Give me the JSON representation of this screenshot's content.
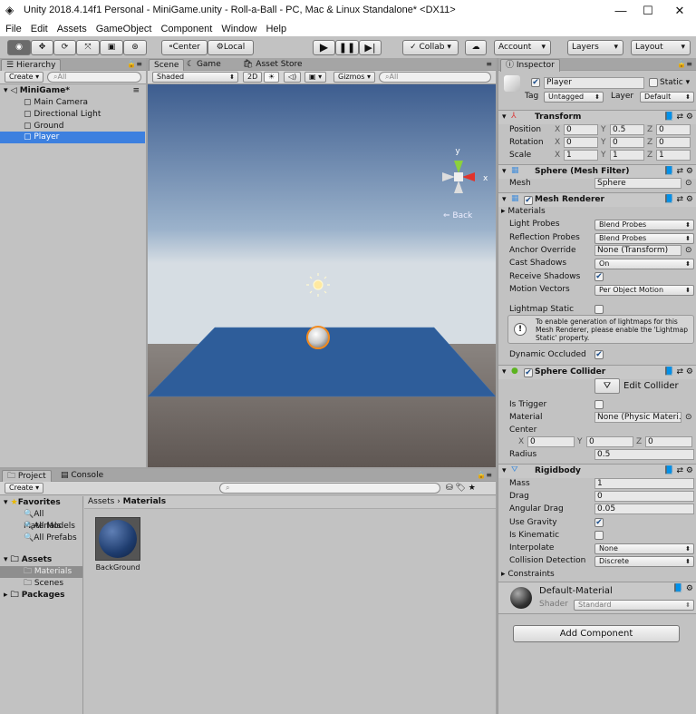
{
  "window": {
    "title": "Unity 2018.4.14f1 Personal - MiniGame.unity - Roll-a-Ball - PC, Mac & Linux Standalone* <DX11>",
    "minimize": "—",
    "maximize": "☐",
    "close": "✕"
  },
  "menu": [
    "File",
    "Edit",
    "Assets",
    "GameObject",
    "Component",
    "Window",
    "Help"
  ],
  "toolbar": {
    "center": "Center",
    "local": "Local",
    "collab": "Collab",
    "account": "Account",
    "layers": "Layers",
    "layout": "Layout"
  },
  "hierarchy": {
    "tab": "Hierarchy",
    "create": "Create",
    "search_placeholder": "All",
    "scene": "MiniGame*",
    "items": [
      "Main Camera",
      "Directional Light",
      "Ground",
      "Player"
    ],
    "selected": "Player"
  },
  "scene": {
    "tabs": [
      "Scene",
      "Game",
      "Asset Store"
    ],
    "shading": "Shaded",
    "mode2d": "2D",
    "gizmos": "Gizmos",
    "search_placeholder": "All",
    "back_label": "Back",
    "axes": {
      "y": "y",
      "x": "x"
    }
  },
  "project": {
    "tabs": [
      "Project",
      "Console"
    ],
    "create": "Create",
    "favorites": "Favorites",
    "fav_items": [
      "All Materials",
      "All Models",
      "All Prefabs"
    ],
    "assets": "Assets",
    "asset_items": [
      "Materials",
      "Scenes"
    ],
    "packages": "Packages",
    "breadcrumb": [
      "Assets",
      "Materials"
    ],
    "files": [
      {
        "name": "BackGround",
        "color": "#1e3c6e"
      }
    ]
  },
  "inspector": {
    "tab": "Inspector",
    "name": "Player",
    "active": true,
    "static_label": "Static",
    "tag_label": "Tag",
    "tag": "Untagged",
    "layer_label": "Layer",
    "layer": "Default",
    "rows": [
      {
        "type": "header",
        "label": "Transform"
      },
      {
        "type": "vec",
        "label": "Position",
        "x": "0",
        "y": "0.5",
        "z": "0"
      },
      {
        "type": "vec",
        "label": "Rotation",
        "x": "0",
        "y": "0",
        "z": "0"
      },
      {
        "type": "vec",
        "label": "Scale",
        "x": "1",
        "y": "1",
        "z": "1"
      },
      {
        "type": "header",
        "label": "Sphere (Mesh Filter)"
      },
      {
        "type": "obj",
        "label": "Mesh",
        "value": "Sphere"
      },
      {
        "type": "header",
        "label": "Mesh Renderer",
        "check": true
      },
      {
        "type": "fold",
        "label": "Materials"
      },
      {
        "type": "drop",
        "label": "Light Probes",
        "value": "Blend Probes"
      },
      {
        "type": "drop",
        "label": "Reflection Probes",
        "value": "Blend Probes"
      },
      {
        "type": "obj",
        "label": "Anchor Override",
        "value": "None (Transform)"
      },
      {
        "type": "drop",
        "label": "Cast Shadows",
        "value": "On"
      },
      {
        "type": "check",
        "label": "Receive Shadows",
        "value": true
      },
      {
        "type": "drop",
        "label": "Motion Vectors",
        "value": "Per Object Motion"
      },
      {
        "type": "check",
        "label": "Lightmap Static",
        "value": false
      },
      {
        "type": "help",
        "label": "To enable generation of lightmaps for this Mesh Renderer, please enable the 'Lightmap Static' property."
      },
      {
        "type": "check",
        "label": "Dynamic Occluded",
        "value": true
      },
      {
        "type": "header",
        "label": "Sphere Collider",
        "check": true
      },
      {
        "type": "button",
        "label": "Edit Collider"
      },
      {
        "type": "check",
        "label": "Is Trigger",
        "value": false
      },
      {
        "type": "obj",
        "label": "Material",
        "value": "None (Physic Materi."
      },
      {
        "type": "plain",
        "label": "Center"
      },
      {
        "type": "vec2",
        "label": "",
        "x": "0",
        "y": "0",
        "z": "0"
      },
      {
        "type": "text",
        "label": "Radius",
        "value": "0.5"
      },
      {
        "type": "header",
        "label": "Rigidbody"
      },
      {
        "type": "text",
        "label": "Mass",
        "value": "1"
      },
      {
        "type": "text",
        "label": "Drag",
        "value": "0"
      },
      {
        "type": "text",
        "label": "Angular Drag",
        "value": "0.05"
      },
      {
        "type": "check",
        "label": "Use Gravity",
        "value": true
      },
      {
        "type": "check",
        "label": "Is Kinematic",
        "value": false
      },
      {
        "type": "drop",
        "label": "Interpolate",
        "value": "None"
      },
      {
        "type": "drop",
        "label": "Collision Detection",
        "value": "Discrete"
      },
      {
        "type": "fold",
        "label": "Constraints"
      }
    ],
    "material": {
      "name": "Default-Material",
      "shader_label": "Shader",
      "shader": "Standard"
    },
    "add_component": "Add Component"
  },
  "colors": {
    "selection": "#3d80df",
    "plane": "#2e5d9a",
    "accent": "#f28a1e"
  }
}
